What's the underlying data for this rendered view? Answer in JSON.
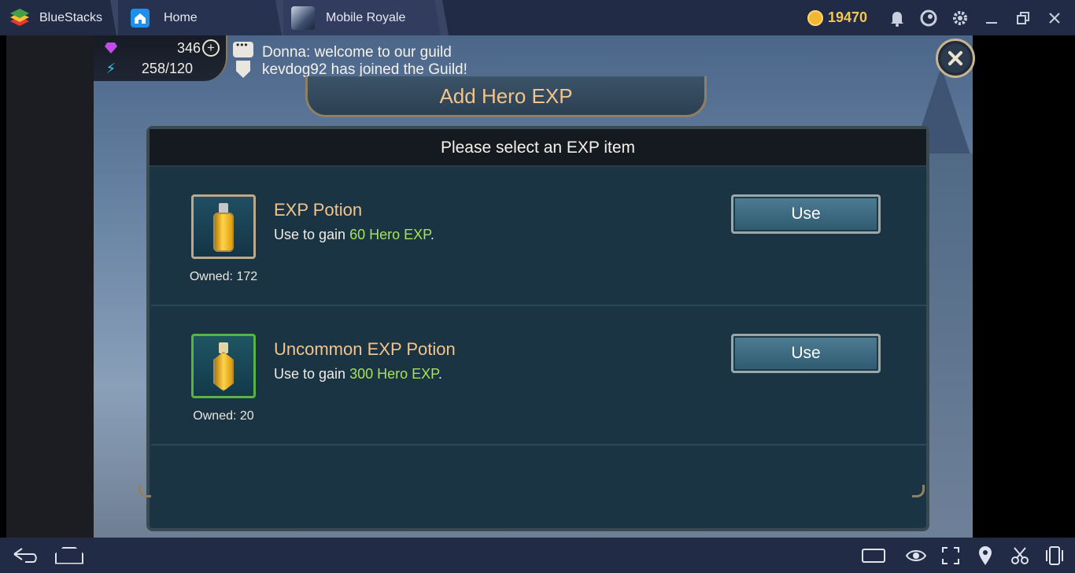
{
  "titlebar": {
    "app_name": "BlueStacks",
    "tabs": [
      {
        "label": "Home"
      },
      {
        "label": "Mobile Royale"
      }
    ],
    "coins": "19470"
  },
  "hud": {
    "gems": "346",
    "energy": "258/120"
  },
  "chat": {
    "line1": "Donna: welcome to our guild",
    "line2": "kevdog92 has joined the Guild!"
  },
  "dialog": {
    "title": "Add Hero EXP",
    "header": "Please select an EXP item",
    "items": [
      {
        "name": "EXP Potion",
        "desc_prefix": "Use to gain ",
        "desc_amount": "60 Hero EXP",
        "desc_suffix": ".",
        "owned": "Owned: 172",
        "button": "Use",
        "rarity": "common"
      },
      {
        "name": "Uncommon EXP Potion",
        "desc_prefix": "Use to gain ",
        "desc_amount": "300 Hero EXP",
        "desc_suffix": ".",
        "owned": "Owned: 20",
        "button": "Use",
        "rarity": "uncommon"
      }
    ]
  },
  "colors": {
    "accent_gold": "#f2c48b",
    "amount_green": "#a6e157",
    "uncommon_border": "#57b343",
    "titlebar_bg": "#212b45"
  },
  "icons": {
    "titlebar": [
      "bell-icon",
      "profile-icon",
      "gear-icon",
      "minimize-icon",
      "restore-icon",
      "close-icon"
    ],
    "bottombar": [
      "back-icon",
      "home-icon",
      "keyboard-icon",
      "eye-icon",
      "fullscreen-icon",
      "location-icon",
      "scissors-icon",
      "phone-rotate-icon"
    ]
  }
}
